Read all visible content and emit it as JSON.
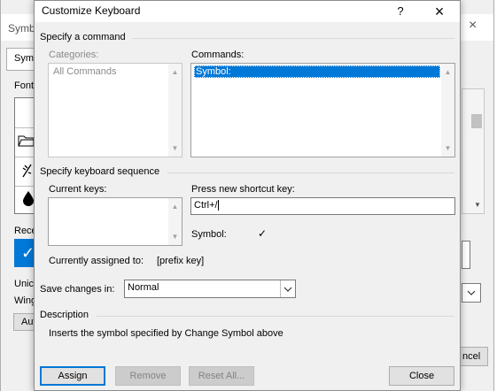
{
  "background_dialog": {
    "title_fragment": "Symb",
    "tab_fragment": "Symb",
    "font_fragment": "Font",
    "recent_fragment": "Rece",
    "unicode_fragment": "Unic",
    "wing_fragment": "Wing",
    "auto_fragment": "Aut",
    "cancel_fragment": "ncel"
  },
  "dialog": {
    "title": "Customize Keyboard",
    "help_label": "?",
    "close_label": "×",
    "specify_command": {
      "group_label": "Specify a command",
      "categories_label": "Categories:",
      "categories": [
        "All Commands"
      ],
      "commands_label": "Commands:",
      "commands": [
        "Symbol:"
      ]
    },
    "keyboard_sequence": {
      "group_label": "Specify keyboard sequence",
      "current_keys_label": "Current keys:",
      "new_key_label": "Press new shortcut key:",
      "new_key_value": "Ctrl+/",
      "symbol_label": "Symbol:",
      "symbol_value": "✓",
      "assigned_label": "Currently assigned to:",
      "assigned_value": "[prefix key]"
    },
    "save_changes": {
      "label": "Save changes in:",
      "value": "Normal"
    },
    "description": {
      "group_label": "Description",
      "text": "Inserts the symbol specified by Change Symbol above"
    },
    "buttons": {
      "assign": "Assign",
      "remove": "Remove",
      "reset_all": "Reset All...",
      "close": "Close"
    }
  }
}
